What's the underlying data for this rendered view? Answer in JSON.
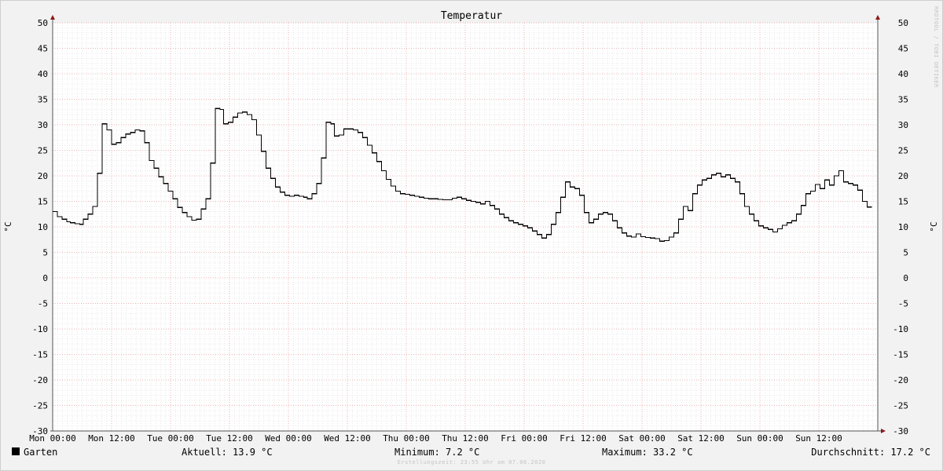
{
  "chart_data": {
    "type": "line",
    "line_style": "step",
    "title": "Temperatur",
    "ylabel": "°C",
    "ylabel_right": "°C",
    "ylim": [
      -30,
      50
    ],
    "y_ticks": [
      50,
      45,
      40,
      35,
      30,
      25,
      20,
      15,
      10,
      5,
      0,
      -5,
      -10,
      -15,
      -20,
      -25,
      -30
    ],
    "xlim": [
      0,
      14
    ],
    "x_unit": "half-days since Mon 00:00",
    "x_ticks": [
      {
        "x": 0,
        "label": "Mon 00:00"
      },
      {
        "x": 1,
        "label": "Mon 12:00"
      },
      {
        "x": 2,
        "label": "Tue 00:00"
      },
      {
        "x": 3,
        "label": "Tue 12:00"
      },
      {
        "x": 4,
        "label": "Wed 00:00"
      },
      {
        "x": 5,
        "label": "Wed 12:00"
      },
      {
        "x": 6,
        "label": "Thu 00:00"
      },
      {
        "x": 7,
        "label": "Thu 12:00"
      },
      {
        "x": 8,
        "label": "Fri 00:00"
      },
      {
        "x": 9,
        "label": "Fri 12:00"
      },
      {
        "x": 10,
        "label": "Sat 00:00"
      },
      {
        "x": 11,
        "label": "Sat 12:00"
      },
      {
        "x": 12,
        "label": "Sun 00:00"
      },
      {
        "x": 13,
        "label": "Sun 12:00"
      }
    ],
    "grid": true,
    "series": [
      {
        "name": "Garten",
        "color": "#000000",
        "points": [
          [
            0.0,
            13.0
          ],
          [
            0.08,
            12.0
          ],
          [
            0.16,
            11.5
          ],
          [
            0.24,
            11.0
          ],
          [
            0.3,
            10.8
          ],
          [
            0.38,
            10.6
          ],
          [
            0.46,
            10.5
          ],
          [
            0.52,
            11.5
          ],
          [
            0.6,
            12.5
          ],
          [
            0.68,
            14.0
          ],
          [
            0.76,
            20.5
          ],
          [
            0.84,
            30.2
          ],
          [
            0.92,
            29.0
          ],
          [
            1.0,
            26.2
          ],
          [
            1.08,
            26.5
          ],
          [
            1.16,
            27.5
          ],
          [
            1.24,
            28.2
          ],
          [
            1.32,
            28.5
          ],
          [
            1.4,
            29.0
          ],
          [
            1.48,
            28.8
          ],
          [
            1.56,
            26.5
          ],
          [
            1.64,
            23.0
          ],
          [
            1.72,
            21.5
          ],
          [
            1.8,
            19.8
          ],
          [
            1.88,
            18.5
          ],
          [
            1.96,
            17.0
          ],
          [
            2.04,
            15.5
          ],
          [
            2.12,
            13.8
          ],
          [
            2.2,
            12.8
          ],
          [
            2.28,
            12.0
          ],
          [
            2.36,
            11.3
          ],
          [
            2.44,
            11.5
          ],
          [
            2.52,
            13.5
          ],
          [
            2.6,
            15.5
          ],
          [
            2.68,
            22.5
          ],
          [
            2.76,
            33.2
          ],
          [
            2.84,
            33.0
          ],
          [
            2.9,
            30.2
          ],
          [
            2.98,
            30.5
          ],
          [
            3.06,
            31.5
          ],
          [
            3.14,
            32.3
          ],
          [
            3.22,
            32.5
          ],
          [
            3.3,
            32.0
          ],
          [
            3.38,
            31.0
          ],
          [
            3.46,
            28.0
          ],
          [
            3.54,
            24.8
          ],
          [
            3.62,
            21.5
          ],
          [
            3.7,
            19.5
          ],
          [
            3.78,
            17.8
          ],
          [
            3.86,
            16.8
          ],
          [
            3.94,
            16.2
          ],
          [
            4.02,
            16.0
          ],
          [
            4.1,
            16.2
          ],
          [
            4.18,
            16.0
          ],
          [
            4.26,
            15.8
          ],
          [
            4.32,
            15.5
          ],
          [
            4.4,
            16.5
          ],
          [
            4.48,
            18.5
          ],
          [
            4.56,
            23.5
          ],
          [
            4.64,
            30.5
          ],
          [
            4.72,
            30.2
          ],
          [
            4.78,
            27.8
          ],
          [
            4.86,
            28.0
          ],
          [
            4.94,
            29.2
          ],
          [
            5.02,
            29.2
          ],
          [
            5.1,
            29.0
          ],
          [
            5.18,
            28.5
          ],
          [
            5.26,
            27.5
          ],
          [
            5.34,
            26.0
          ],
          [
            5.42,
            24.5
          ],
          [
            5.5,
            22.8
          ],
          [
            5.58,
            21.0
          ],
          [
            5.66,
            19.3
          ],
          [
            5.74,
            18.0
          ],
          [
            5.82,
            17.0
          ],
          [
            5.9,
            16.5
          ],
          [
            5.98,
            16.4
          ],
          [
            6.06,
            16.2
          ],
          [
            6.14,
            16.0
          ],
          [
            6.22,
            15.8
          ],
          [
            6.3,
            15.6
          ],
          [
            6.38,
            15.5
          ],
          [
            6.46,
            15.5
          ],
          [
            6.54,
            15.4
          ],
          [
            6.62,
            15.3
          ],
          [
            6.7,
            15.3
          ],
          [
            6.78,
            15.6
          ],
          [
            6.86,
            15.8
          ],
          [
            6.94,
            15.5
          ],
          [
            7.02,
            15.2
          ],
          [
            7.1,
            15.0
          ],
          [
            7.18,
            14.8
          ],
          [
            7.26,
            14.5
          ],
          [
            7.34,
            15.0
          ],
          [
            7.42,
            14.2
          ],
          [
            7.5,
            13.5
          ],
          [
            7.58,
            12.5
          ],
          [
            7.66,
            11.8
          ],
          [
            7.74,
            11.2
          ],
          [
            7.82,
            10.8
          ],
          [
            7.9,
            10.5
          ],
          [
            7.98,
            10.2
          ],
          [
            8.06,
            9.8
          ],
          [
            8.14,
            9.2
          ],
          [
            8.22,
            8.5
          ],
          [
            8.3,
            7.8
          ],
          [
            8.38,
            8.5
          ],
          [
            8.46,
            10.5
          ],
          [
            8.54,
            12.8
          ],
          [
            8.62,
            15.8
          ],
          [
            8.7,
            18.8
          ],
          [
            8.78,
            17.8
          ],
          [
            8.86,
            17.5
          ],
          [
            8.94,
            16.2
          ],
          [
            9.02,
            12.8
          ],
          [
            9.1,
            10.8
          ],
          [
            9.18,
            11.5
          ],
          [
            9.26,
            12.5
          ],
          [
            9.34,
            12.8
          ],
          [
            9.42,
            12.5
          ],
          [
            9.5,
            11.2
          ],
          [
            9.58,
            9.8
          ],
          [
            9.66,
            8.8
          ],
          [
            9.74,
            8.2
          ],
          [
            9.82,
            8.0
          ],
          [
            9.9,
            8.6
          ],
          [
            9.98,
            8.1
          ],
          [
            10.06,
            7.9
          ],
          [
            10.14,
            7.8
          ],
          [
            10.22,
            7.7
          ],
          [
            10.3,
            7.2
          ],
          [
            10.38,
            7.3
          ],
          [
            10.46,
            8.0
          ],
          [
            10.54,
            8.8
          ],
          [
            10.62,
            11.5
          ],
          [
            10.7,
            14.0
          ],
          [
            10.78,
            13.2
          ],
          [
            10.86,
            16.5
          ],
          [
            10.94,
            18.2
          ],
          [
            11.02,
            19.2
          ],
          [
            11.1,
            19.5
          ],
          [
            11.18,
            20.2
          ],
          [
            11.26,
            20.5
          ],
          [
            11.34,
            19.8
          ],
          [
            11.42,
            20.2
          ],
          [
            11.5,
            19.5
          ],
          [
            11.58,
            18.8
          ],
          [
            11.66,
            16.5
          ],
          [
            11.74,
            14.0
          ],
          [
            11.82,
            12.5
          ],
          [
            11.9,
            11.2
          ],
          [
            11.98,
            10.2
          ],
          [
            12.06,
            9.8
          ],
          [
            12.14,
            9.5
          ],
          [
            12.22,
            9.0
          ],
          [
            12.3,
            9.6
          ],
          [
            12.38,
            10.3
          ],
          [
            12.46,
            10.8
          ],
          [
            12.54,
            11.2
          ],
          [
            12.62,
            12.5
          ],
          [
            12.7,
            14.2
          ],
          [
            12.78,
            16.5
          ],
          [
            12.86,
            17.0
          ],
          [
            12.94,
            18.3
          ],
          [
            13.02,
            17.5
          ],
          [
            13.1,
            19.2
          ],
          [
            13.18,
            18.2
          ],
          [
            13.26,
            20.0
          ],
          [
            13.34,
            21.0
          ],
          [
            13.42,
            18.8
          ],
          [
            13.5,
            18.5
          ],
          [
            13.58,
            18.2
          ],
          [
            13.66,
            17.2
          ],
          [
            13.74,
            15.0
          ],
          [
            13.82,
            13.9
          ],
          [
            13.9,
            13.9
          ]
        ]
      }
    ]
  },
  "legend": {
    "series_name": "Garten",
    "current": "Aktuell: 13.9 °C",
    "minimum": "Minimum: 7.2 °C",
    "maximum": "Maximum: 33.2 °C",
    "average": "Durchschnitt: 17.2 °C"
  },
  "footer": "Erstellungszeit: 23:55 Uhr am 07.06.2020",
  "credit": "RRDTOOL / TOBI OETIKER"
}
